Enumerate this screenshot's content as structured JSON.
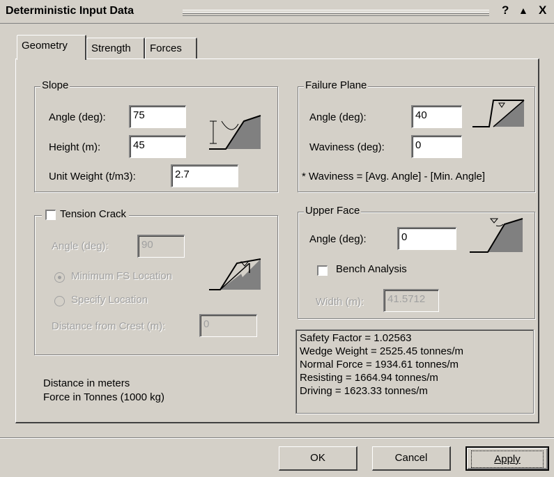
{
  "window": {
    "title": "Deterministic Input Data",
    "help_glyph": "?",
    "minimize_glyph": "▲",
    "close_glyph": "X"
  },
  "tabs": [
    {
      "label": "Geometry",
      "active": true
    },
    {
      "label": "Strength",
      "active": false
    },
    {
      "label": "Forces",
      "active": false
    }
  ],
  "slope": {
    "legend": "Slope",
    "angle_label": "Angle (deg):",
    "angle_value": "75",
    "height_label": "Height (m):",
    "height_value": "45",
    "unit_weight_label": "Unit Weight (t/m3):",
    "unit_weight_value": "2.7"
  },
  "failure_plane": {
    "legend": "Failure Plane",
    "angle_label": "Angle (deg):",
    "angle_value": "40",
    "waviness_label": "Waviness (deg):",
    "waviness_value": "0",
    "note": "* Waviness = [Avg. Angle] - [Min. Angle]"
  },
  "tension_crack": {
    "legend": "Tension Crack",
    "checked": false,
    "angle_label": "Angle (deg):",
    "angle_value": "90",
    "option_min_fs": "Minimum FS Location",
    "option_specify": "Specify Location",
    "distance_label": "Distance from Crest (m):",
    "distance_value": "0"
  },
  "upper_face": {
    "legend": "Upper Face",
    "angle_label": "Angle (deg):",
    "angle_value": "0",
    "bench_label": "Bench Analysis",
    "bench_checked": false,
    "width_label": "Width (m):",
    "width_value": "41.5712"
  },
  "units_note": {
    "line1": "Distance in meters",
    "line2": "Force in Tonnes (1000 kg)"
  },
  "results": {
    "line1": "Safety Factor = 1.02563",
    "line2": "Wedge Weight = 2525.45 tonnes/m",
    "line3": "Normal Force = 1934.61 tonnes/m",
    "line4": "Resisting = 1664.94 tonnes/m",
    "line5": "Driving = 1623.33 tonnes/m"
  },
  "buttons": {
    "ok": "OK",
    "cancel": "Cancel",
    "apply": "Apply"
  },
  "colors": {
    "face": "#d4d0c8",
    "diagram_fill": "#808080"
  }
}
